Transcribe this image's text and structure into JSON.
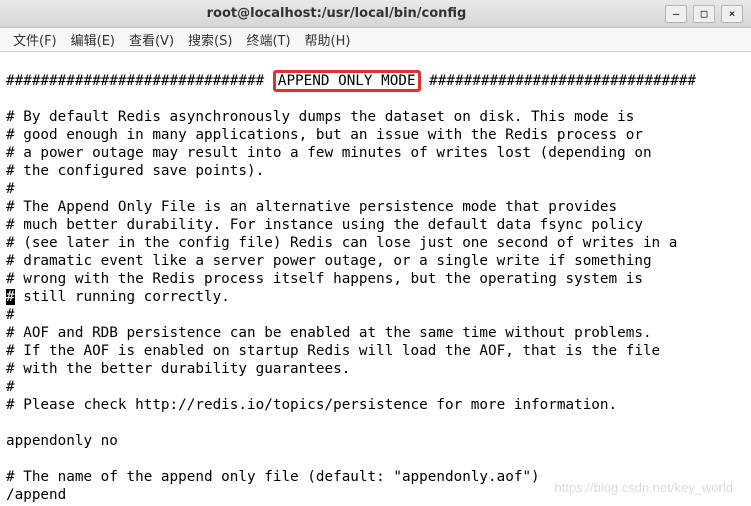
{
  "titlebar": {
    "title": "root@localhost:/usr/local/bin/config"
  },
  "win_controls": {
    "minimize": "–",
    "maximize": "□",
    "close": "×"
  },
  "menubar": {
    "file": "文件(F)",
    "edit": "编辑(E)",
    "view": "查看(V)",
    "search": "搜索(S)",
    "terminal": "终端(T)",
    "help": "帮助(H)"
  },
  "content": {
    "hash_prefix": "############################## ",
    "section_title": "APPEND ONLY MODE",
    "hash_suffix": " ###############################",
    "blank": "",
    "l1": "# By default Redis asynchronously dumps the dataset on disk. This mode is",
    "l2": "# good enough in many applications, but an issue with the Redis process or",
    "l3": "# a power outage may result into a few minutes of writes lost (depending on",
    "l4": "# the configured save points).",
    "l5": "#",
    "l6": "# The Append Only File is an alternative persistence mode that provides",
    "l7": "# much better durability. For instance using the default data fsync policy",
    "l8": "# (see later in the config file) Redis can lose just one second of writes in a",
    "l9": "# dramatic event like a server power outage, or a single write if something",
    "l10": "# wrong with the Redis process itself happens, but the operating system is",
    "l11a": "#",
    "l11b": " still running correctly.",
    "l12": "#",
    "l13": "# AOF and RDB persistence can be enabled at the same time without problems.",
    "l14": "# If the AOF is enabled on startup Redis will load the AOF, that is the file",
    "l15": "# with the better durability guarantees.",
    "l16": "#",
    "l17": "# Please check http://redis.io/topics/persistence for more information.",
    "l18": "",
    "l19": "appendonly no",
    "l20": "",
    "l21": "# The name of the append only file (default: \"appendonly.aof\")",
    "l22": "/append"
  },
  "watermark": "https://blog.csdn.net/key_world"
}
